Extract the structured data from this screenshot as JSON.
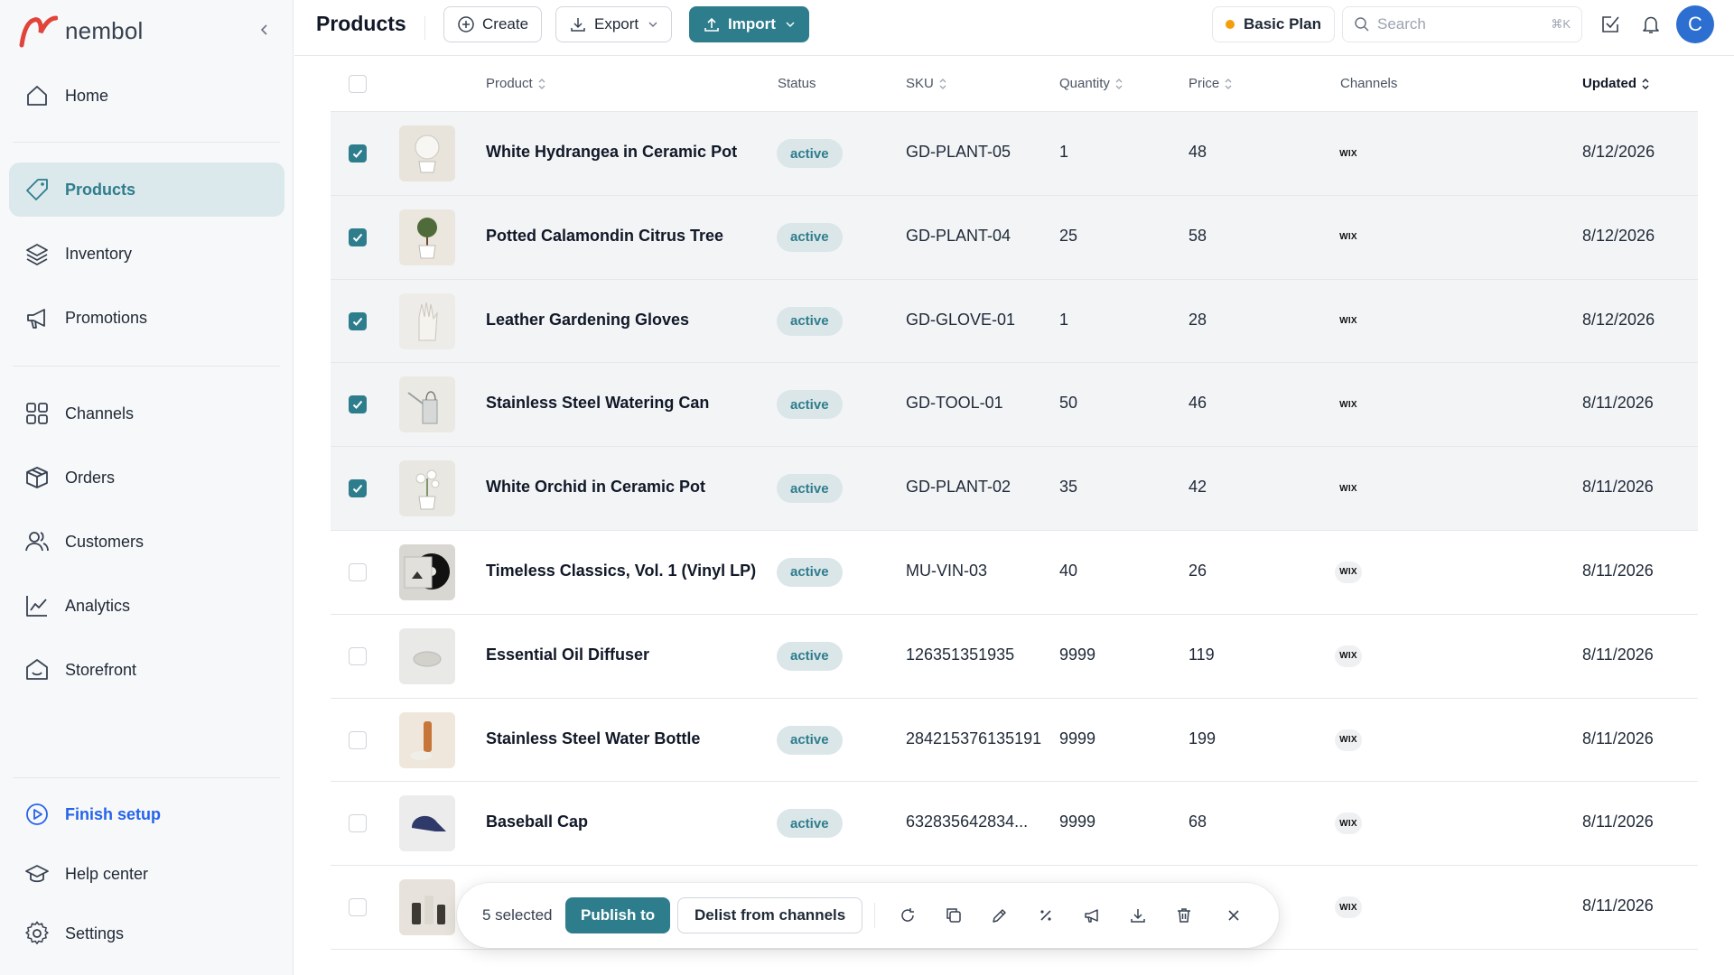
{
  "brand": {
    "name": "nembol"
  },
  "sidebar": {
    "items": [
      {
        "label": "Home",
        "icon": "home-icon"
      },
      {
        "label": "Products",
        "icon": "tag-icon"
      },
      {
        "label": "Inventory",
        "icon": "layers-icon"
      },
      {
        "label": "Promotions",
        "icon": "megaphone-icon"
      },
      {
        "label": "Channels",
        "icon": "grid-icon"
      },
      {
        "label": "Orders",
        "icon": "box-icon"
      },
      {
        "label": "Customers",
        "icon": "users-icon"
      },
      {
        "label": "Analytics",
        "icon": "chart-icon"
      },
      {
        "label": "Storefront",
        "icon": "storefront-icon"
      }
    ],
    "active": "Products",
    "bottom": [
      {
        "label": "Finish setup",
        "icon": "play-circle-icon"
      },
      {
        "label": "Help center",
        "icon": "graduation-cap-icon"
      },
      {
        "label": "Settings",
        "icon": "gear-icon"
      }
    ]
  },
  "header": {
    "title": "Products",
    "create_label": "Create",
    "export_label": "Export",
    "import_label": "Import",
    "plan_label": "Basic Plan",
    "search_placeholder": "Search",
    "search_shortcut": "⌘K",
    "avatar_initial": "C"
  },
  "colors": {
    "accent": "#2e7d8c",
    "avatar": "#2c6fd1",
    "plan_dot": "#f59e0b"
  },
  "table": {
    "columns": {
      "product": "Product",
      "status": "Status",
      "sku": "SKU",
      "quantity": "Quantity",
      "price": "Price",
      "channels": "Channels",
      "updated": "Updated"
    },
    "channel_label": "WIX",
    "rows": [
      {
        "name": "White Hydrangea in Ceramic Pot",
        "status": "active",
        "sku": "GD-PLANT-05",
        "quantity": "1",
        "price": "48",
        "updated": "8/12/2026",
        "selected": true
      },
      {
        "name": "Potted Calamondin Citrus Tree",
        "status": "active",
        "sku": "GD-PLANT-04",
        "quantity": "25",
        "price": "58",
        "updated": "8/12/2026",
        "selected": true
      },
      {
        "name": "Leather Gardening Gloves",
        "status": "active",
        "sku": "GD-GLOVE-01",
        "quantity": "1",
        "price": "28",
        "updated": "8/12/2026",
        "selected": true
      },
      {
        "name": "Stainless Steel Watering Can",
        "status": "active",
        "sku": "GD-TOOL-01",
        "quantity": "50",
        "price": "46",
        "updated": "8/11/2026",
        "selected": true
      },
      {
        "name": "White Orchid in Ceramic Pot",
        "status": "active",
        "sku": "GD-PLANT-02",
        "quantity": "35",
        "price": "42",
        "updated": "8/11/2026",
        "selected": true
      },
      {
        "name": "Timeless Classics, Vol. 1 (Vinyl LP)",
        "status": "active",
        "sku": "MU-VIN-03",
        "quantity": "40",
        "price": "26",
        "updated": "8/11/2026",
        "selected": false
      },
      {
        "name": "Essential Oil Diffuser",
        "status": "active",
        "sku": "126351351935",
        "quantity": "9999",
        "price": "119",
        "updated": "8/11/2026",
        "selected": false
      },
      {
        "name": "Stainless Steel Water Bottle",
        "status": "active",
        "sku": "284215376135191",
        "quantity": "9999",
        "price": "199",
        "updated": "8/11/2026",
        "selected": false
      },
      {
        "name": "Baseball Cap",
        "status": "active",
        "sku": "632835642834...",
        "quantity": "9999",
        "price": "68",
        "updated": "8/11/2026",
        "selected": false
      },
      {
        "name": "",
        "status": "",
        "sku": "",
        "quantity": "",
        "price": "",
        "updated": "8/11/2026",
        "selected": false
      }
    ]
  },
  "bulk_bar": {
    "count_label": "5 selected",
    "publish_label": "Publish to",
    "delist_label": "Delist from channels",
    "actions": [
      "refresh-icon",
      "duplicate-icon",
      "edit-icon",
      "discount-icon",
      "promote-icon",
      "download-icon",
      "trash-icon",
      "close-icon"
    ]
  }
}
